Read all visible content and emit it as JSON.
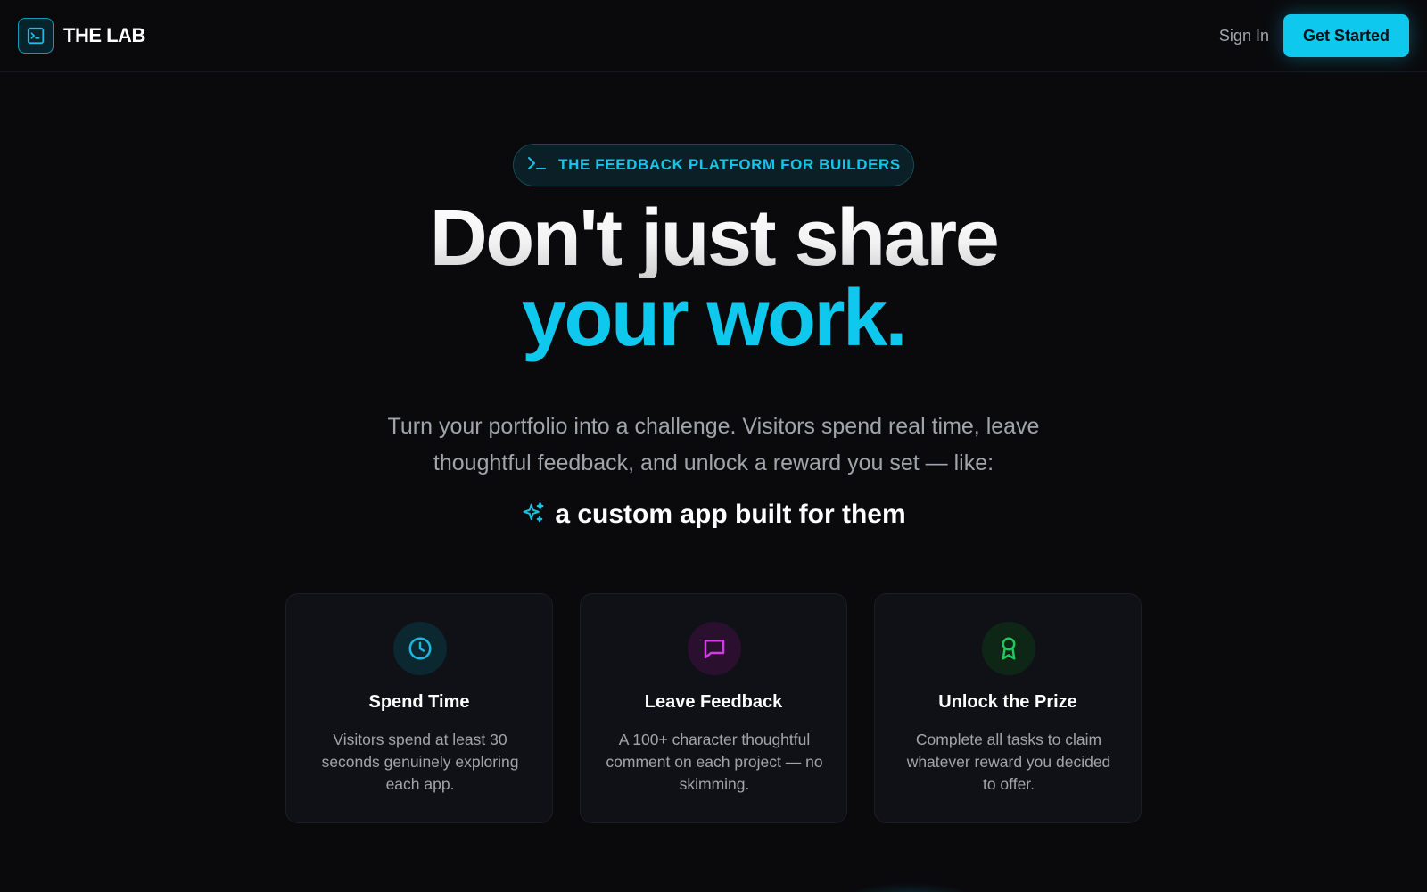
{
  "brand": {
    "name": "THE LAB",
    "logo_icon": "terminal-icon",
    "accent": "#0fc8ee"
  },
  "nav": {
    "signin_label": "Sign In",
    "cta_label": "Get Started"
  },
  "hero": {
    "badge": {
      "icon": "terminal-prompt-icon",
      "text": "THE FEEDBACK PLATFORM FOR BUILDERS"
    },
    "headline_line1": "Don't just share",
    "headline_line2": "your work.",
    "subtitle": "Turn your portfolio into a challenge. Visitors spend real time, leave thoughtful feedback, and unlock a reward you set — like:",
    "tagline_icon": "sparkles-icon",
    "tagline": "a custom app built for them"
  },
  "cards": [
    {
      "icon": "clock-icon",
      "icon_color": "#19b8e0",
      "title": "Spend Time",
      "description": "Visitors spend at least 30 seconds genuinely exploring each app."
    },
    {
      "icon": "message-square-icon",
      "icon_color": "#d23ce6",
      "title": "Leave Feedback",
      "description": "A 100+ character thoughtful comment on each project — no skimming."
    },
    {
      "icon": "award-icon",
      "icon_color": "#22c55e",
      "title": "Unlock the Prize",
      "description": "Complete all tasks to claim whatever reward you decided to offer."
    }
  ]
}
